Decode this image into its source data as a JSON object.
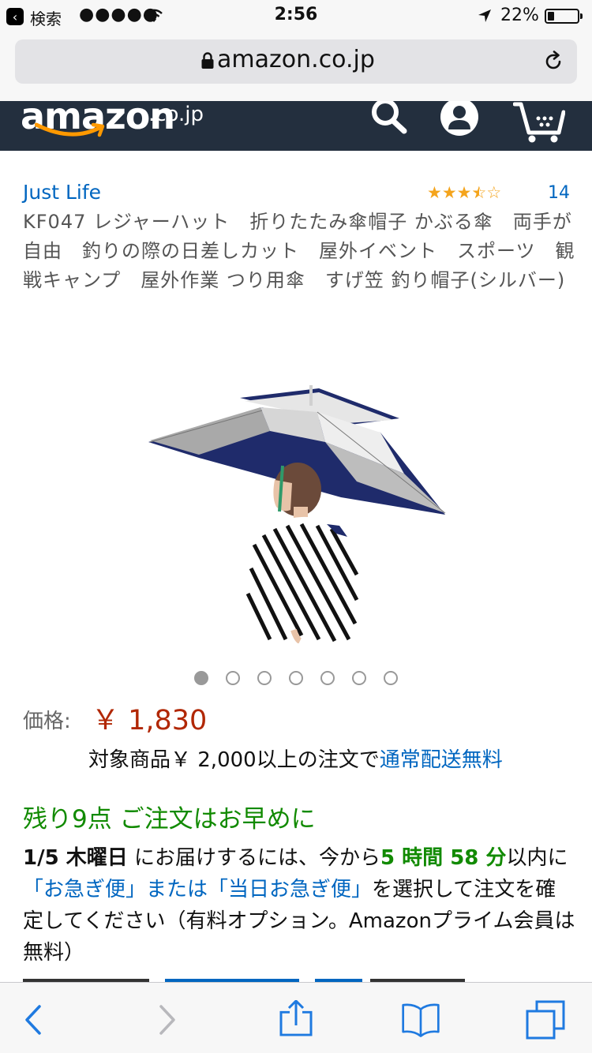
{
  "status_bar": {
    "back_app": "検索",
    "signal": "●●●●●",
    "time": "2:56",
    "battery_percent": "22%",
    "battery_level": 0.22
  },
  "browser": {
    "url": "amazon.co.jp"
  },
  "amazon_header": {
    "logo_text": "amazon",
    "logo_tld": ".co.jp"
  },
  "product": {
    "brand": "Just Life",
    "rating_stars": 3.5,
    "rating_count": "14",
    "title": "KF047 レジャーハット　折りたたみ傘帽子 かぶる傘　両手が自由　釣りの際の日差しカット　屋外イベント　スポーツ　観戦キャンプ　屋外作業 つり用傘　すげ笠 釣り帽子(シルバー)",
    "image_count": 7,
    "active_image_index": 0
  },
  "pricing": {
    "label": "価格:",
    "price": "￥ 1,830",
    "shipping_prefix": "対象商品￥ 2,000以上の注文で",
    "shipping_link": "通常配送無料"
  },
  "availability": {
    "stock_message": "残り9点 ご注文はお早めに"
  },
  "delivery": {
    "date": "1/5 木曜日",
    "text1": " にお届けするには、今から",
    "countdown": "5 時間 58 分",
    "text2": "以内に",
    "options": "「お急ぎ便」または「当日お急ぎ便」",
    "text3": "を選択して注文を確定してください（有料オプション。Amazonプライム会員は無料）"
  },
  "colors": {
    "amazon_navy": "#232f3e",
    "link_blue": "#0066c0",
    "price_red": "#b12704",
    "stock_green": "#118a00",
    "ios_blue": "#1f7ae0"
  }
}
